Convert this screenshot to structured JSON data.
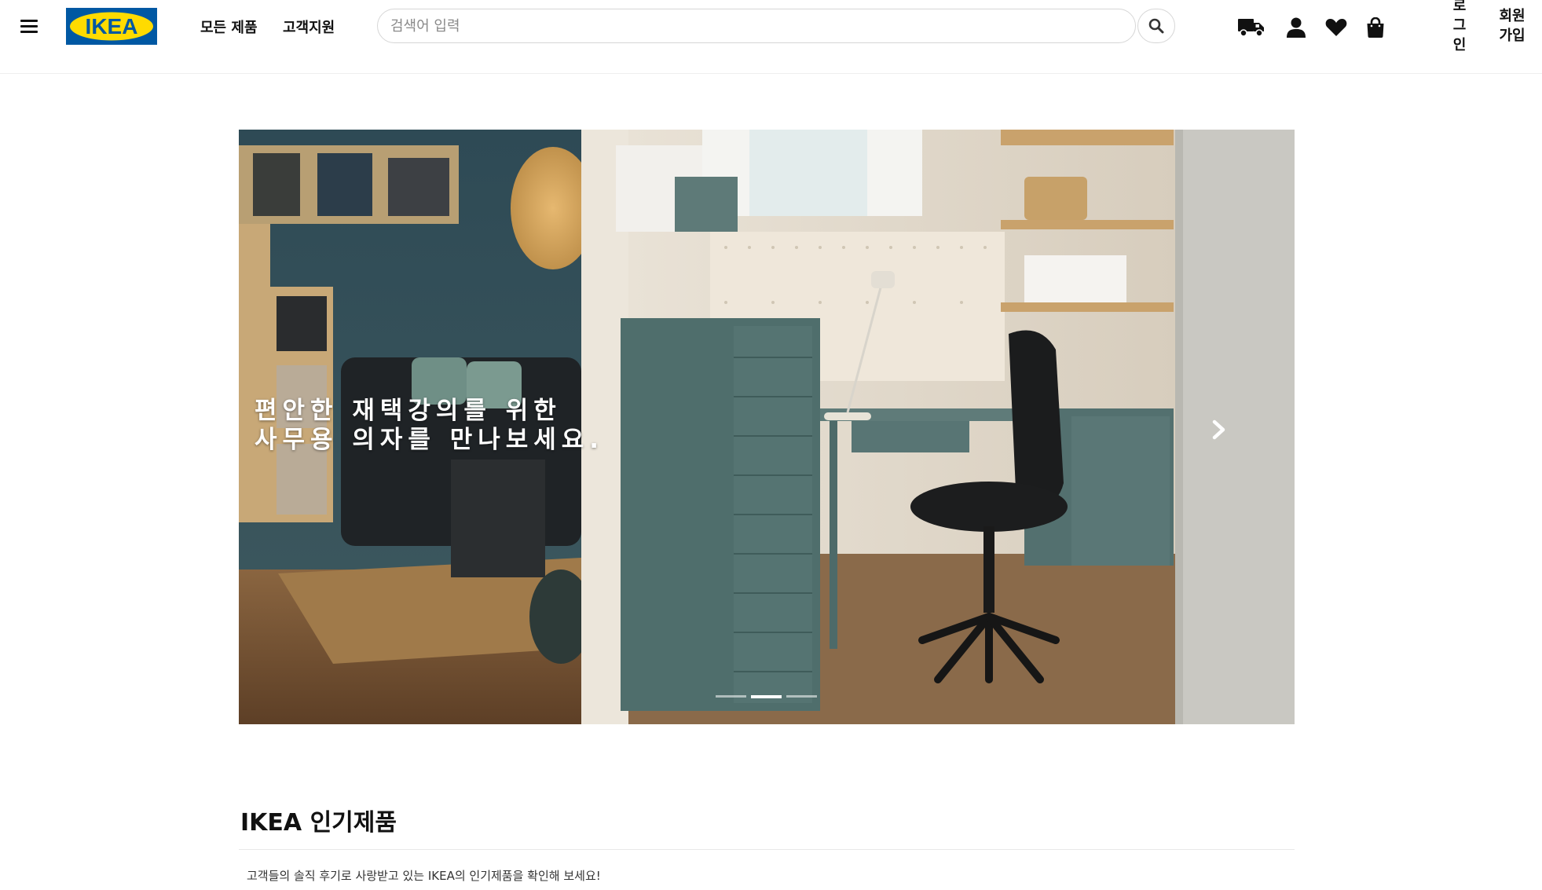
{
  "header": {
    "logo_text": "IKEA",
    "nav": {
      "all_products": "모든 제품",
      "support": "고객지원"
    },
    "search": {
      "placeholder": "검색어 입력"
    },
    "auth": {
      "login": "로\n그\n인",
      "signup": "회원\n가입"
    },
    "icons": [
      "menu-icon",
      "delivery-truck-icon",
      "user-icon",
      "heart-icon",
      "shopping-bag-icon",
      "search-icon"
    ]
  },
  "hero": {
    "caption_line1": "편안한 재택강의를 위한",
    "caption_line2": "사무용 의자를 만나보세요.",
    "slide_count": 3,
    "active_slide": 2
  },
  "popular": {
    "title": "IKEA 인기제품",
    "description": "고객들의 솔직 후기로 사랑받고 있는 IKEA의 인기제품을 확인해 보세요!"
  },
  "colors": {
    "ikea_blue": "#0058A3",
    "ikea_yellow": "#FFDB00",
    "text": "#111111"
  }
}
